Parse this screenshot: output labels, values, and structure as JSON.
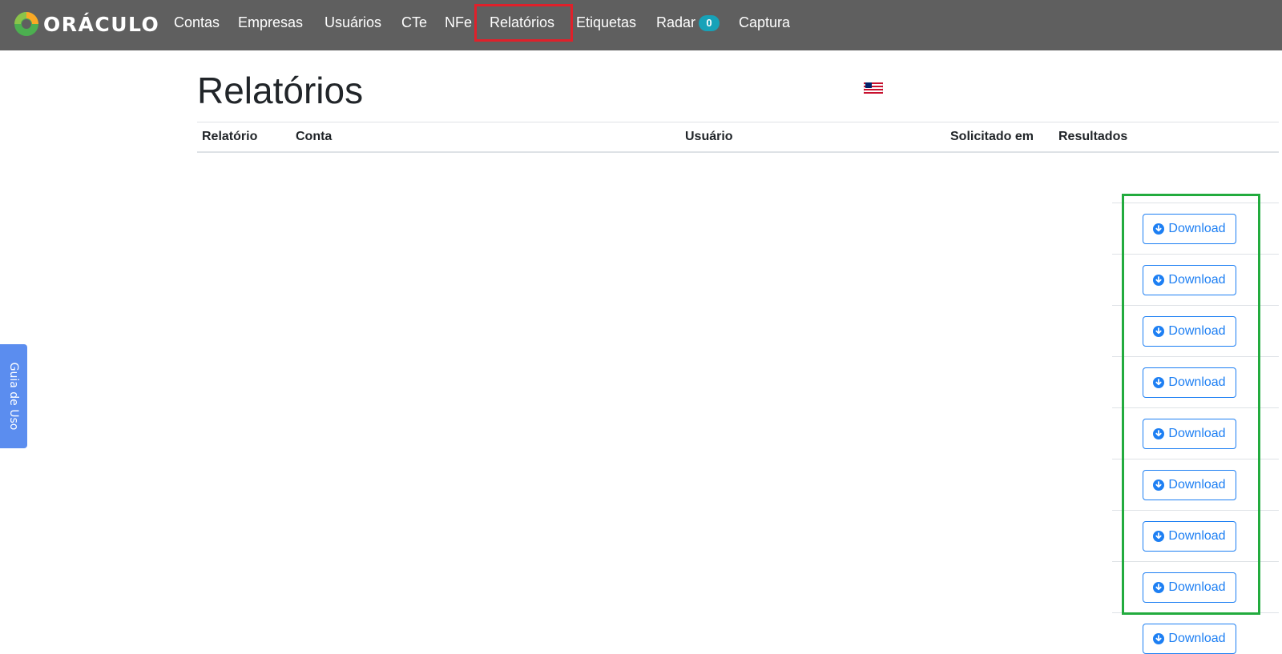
{
  "nav": {
    "brand": "ORÁCULO",
    "items": [
      {
        "label": "Contas"
      },
      {
        "label": "Empresas"
      },
      {
        "label": "Usuários"
      },
      {
        "label": "CTe"
      },
      {
        "label": "NFe"
      },
      {
        "label": "Relatórios",
        "active": true
      },
      {
        "label": "Etiquetas"
      },
      {
        "label": "Radar",
        "badge": "0"
      },
      {
        "label": "Captura"
      }
    ]
  },
  "page": {
    "title": "Relatórios",
    "flag_icon": "uk-flag-icon"
  },
  "table": {
    "headers": [
      "Relatório",
      "Conta",
      "Usuário",
      "Solicitado em",
      "Resultados"
    ],
    "download_label": "Download",
    "download_count": 8
  },
  "side_tab": {
    "label": "Guia de Uso"
  },
  "colors": {
    "navbar": "#5f5f5f",
    "active_outline": "#e0202a",
    "highlight_outline": "#22ab3e",
    "primary": "#1d7ff3",
    "badge": "#17a2b8",
    "side_tab": "#5b8def"
  }
}
